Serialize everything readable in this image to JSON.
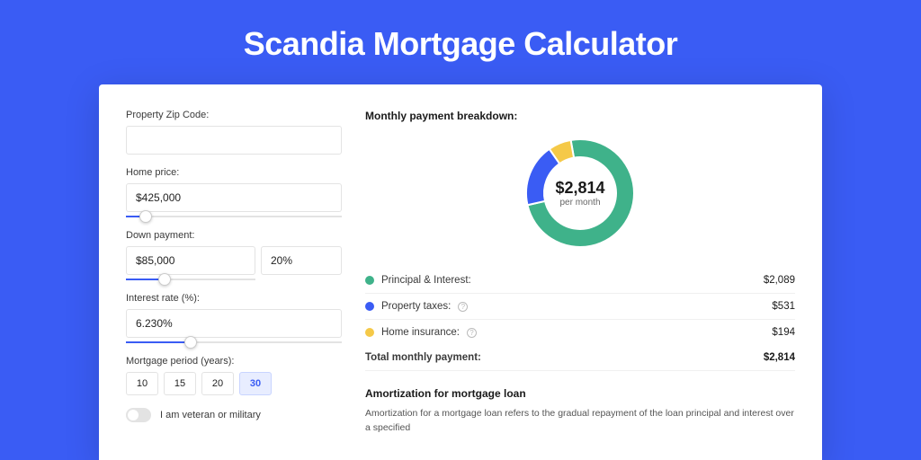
{
  "title": "Scandia Mortgage Calculator",
  "form": {
    "zip": {
      "label": "Property Zip Code:",
      "value": ""
    },
    "home_price": {
      "label": "Home price:",
      "value": "$425,000",
      "slider_percent": 9
    },
    "down_payment": {
      "label": "Down payment:",
      "amount": "$85,000",
      "percent": "20%",
      "slider_percent": 20
    },
    "interest_rate": {
      "label": "Interest rate (%):",
      "value": "6.230%",
      "slider_percent": 30
    },
    "period": {
      "label": "Mortgage period (years):",
      "options": [
        "10",
        "15",
        "20",
        "30"
      ],
      "selected": "30"
    },
    "veteran": {
      "label": "I am veteran or military",
      "on": false
    }
  },
  "breakdown": {
    "title": "Monthly payment breakdown:",
    "center_amount": "$2,814",
    "center_sub": "per month",
    "items": [
      {
        "label": "Principal & Interest:",
        "value": "$2,089",
        "color": "#3fb28a",
        "info": false
      },
      {
        "label": "Property taxes:",
        "value": "$531",
        "color": "#3a5cf4",
        "info": true
      },
      {
        "label": "Home insurance:",
        "value": "$194",
        "color": "#f5c948",
        "info": true
      }
    ],
    "total": {
      "label": "Total monthly payment:",
      "value": "$2,814"
    }
  },
  "chart_data": {
    "type": "pie",
    "title": "Monthly payment breakdown",
    "series": [
      {
        "name": "Principal & Interest",
        "value": 2089
      },
      {
        "name": "Property taxes",
        "value": 531
      },
      {
        "name": "Home insurance",
        "value": 194
      }
    ],
    "total": 2814,
    "currency": "USD"
  },
  "amortization": {
    "title": "Amortization for mortgage loan",
    "text": "Amortization for a mortgage loan refers to the gradual repayment of the loan principal and interest over a specified"
  }
}
